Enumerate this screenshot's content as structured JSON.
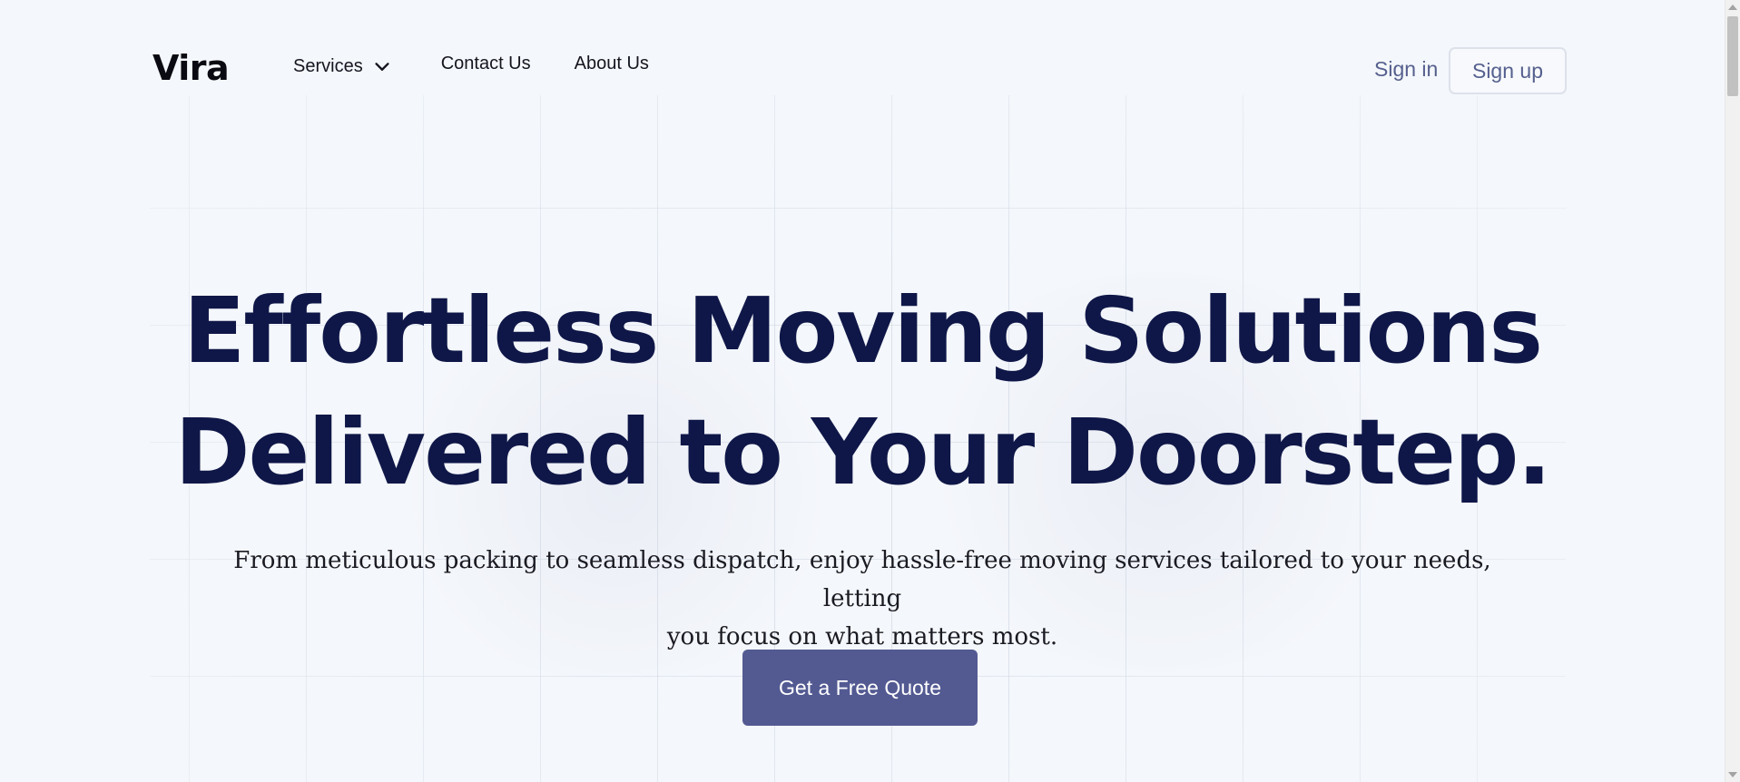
{
  "header": {
    "logo": "Vira",
    "nav": {
      "services_label": "Services",
      "services_icon": "chevron-down-icon",
      "contact_label": "Contact Us",
      "about_label": "About Us"
    },
    "sign_in_label": "Sign in",
    "sign_up_label": "Sign up"
  },
  "hero": {
    "headline_line1": "Effortless Moving Solutions",
    "headline_line2": "Delivered to Your Doorstep.",
    "subtext_line1": "From meticulous packing to seamless dispatch, enjoy hassle-free moving services tailored to your needs, letting",
    "subtext_line2": "you focus on what matters most.",
    "cta_label": "Get a Free Quote"
  },
  "colors": {
    "background": "#f4f7fb",
    "headline": "#0f1748",
    "accent": "#535a92",
    "link": "#56608e"
  }
}
